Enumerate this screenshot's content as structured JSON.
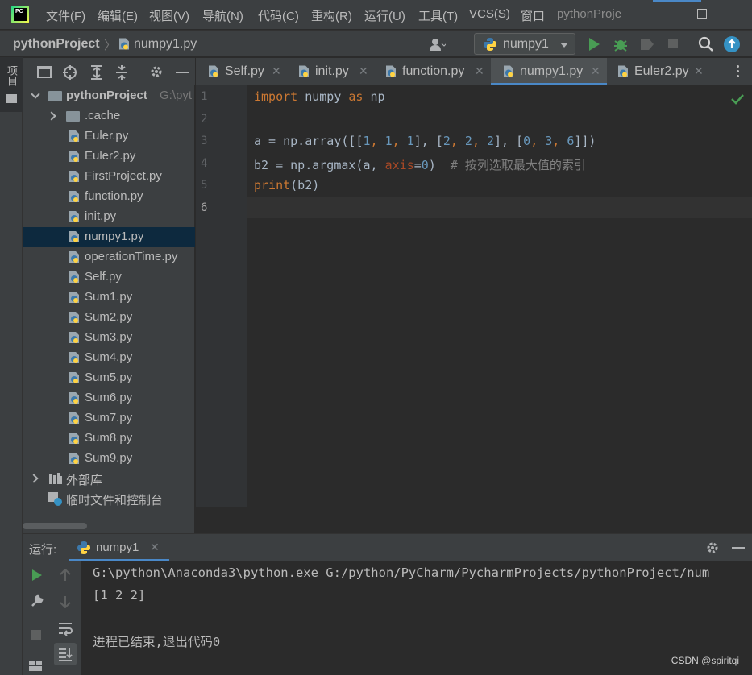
{
  "menu": {
    "items": [
      "文件(F)",
      "编辑(E)",
      "视图(V)",
      "导航(N)",
      "代码(C)",
      "重构(R)",
      "运行(U)",
      "工具(T)",
      "VCS(S)",
      "窗口"
    ],
    "title": "pythonProje"
  },
  "logo_text": "PC",
  "navbar": {
    "crumb_project": "pythonProject",
    "crumb_sep": "〉",
    "crumb_file": "numpy1.py",
    "run_config": "numpy1"
  },
  "left_strip": {
    "project_label": "项目"
  },
  "project": {
    "tree": [
      {
        "label": "pythonProject",
        "suffix": "G:\\pyt",
        "type": "root"
      },
      {
        "label": ".cache",
        "type": "folder"
      },
      {
        "label": "Euler.py",
        "type": "py"
      },
      {
        "label": "Euler2.py",
        "type": "py"
      },
      {
        "label": "FirstProject.py",
        "type": "py"
      },
      {
        "label": "function.py",
        "type": "py"
      },
      {
        "label": "init.py",
        "type": "py"
      },
      {
        "label": "numpy1.py",
        "type": "py",
        "selected": true
      },
      {
        "label": "operationTime.py",
        "type": "py"
      },
      {
        "label": "Self.py",
        "type": "py"
      },
      {
        "label": "Sum1.py",
        "type": "py"
      },
      {
        "label": "Sum2.py",
        "type": "py"
      },
      {
        "label": "Sum3.py",
        "type": "py"
      },
      {
        "label": "Sum4.py",
        "type": "py"
      },
      {
        "label": "Sum5.py",
        "type": "py"
      },
      {
        "label": "Sum6.py",
        "type": "py"
      },
      {
        "label": "Sum7.py",
        "type": "py"
      },
      {
        "label": "Sum8.py",
        "type": "py"
      },
      {
        "label": "Sum9.py",
        "type": "py"
      },
      {
        "label": "外部库",
        "type": "lib"
      },
      {
        "label": "临时文件和控制台",
        "type": "scratch"
      }
    ]
  },
  "tabs": [
    {
      "label": "Self.py"
    },
    {
      "label": "init.py"
    },
    {
      "label": "function.py"
    },
    {
      "label": "numpy1.py",
      "active": true
    },
    {
      "label": "Euler2.py"
    }
  ],
  "editor": {
    "line_numbers": [
      "1",
      "2",
      "3",
      "4",
      "5",
      "6"
    ],
    "code": {
      "l1_kw1": "import",
      "l1_mid": " numpy ",
      "l1_kw2": "as",
      "l1_end": " np",
      "l3_a": "a = np.array([[",
      "l3_n1": "1",
      "l3_c1": ", ",
      "l3_n2": "1",
      "l3_c2": ", ",
      "l3_n3": "1",
      "l3_c3": "], [",
      "l3_n4": "2",
      "l3_c4": ", ",
      "l3_n5": "2",
      "l3_c5": ", ",
      "l3_n6": "2",
      "l3_c6": "], [",
      "l3_n7": "0",
      "l3_c7": ", ",
      "l3_n8": "3",
      "l3_c8": ", ",
      "l3_n9": "6",
      "l3_end": "]])",
      "l4_a": "b2 = np.argmax(a, ",
      "l4_param": "axis",
      "l4_eq": "=",
      "l4_num": "0",
      "l4_close": ")  ",
      "l4_comment": "# 按列选取最大值的索引",
      "l5_fn": "print",
      "l5_rest": "(b2)"
    }
  },
  "run": {
    "label": "运行:",
    "tab": "numpy1",
    "console": [
      "G:\\python\\Anaconda3\\python.exe G:/python/PyCharm/PycharmProjects/pythonProject/num",
      "[1 2 2]",
      "",
      "进程已结束,退出代码0"
    ]
  },
  "watermark": "CSDN @spiritqi",
  "colors": {
    "keyword": "#cc7832",
    "number": "#6897bb",
    "comment": "#808080",
    "param": "#aa4926",
    "builtin": "#8888c6",
    "accent": "#4a88c7",
    "run_green": "#499c54"
  }
}
